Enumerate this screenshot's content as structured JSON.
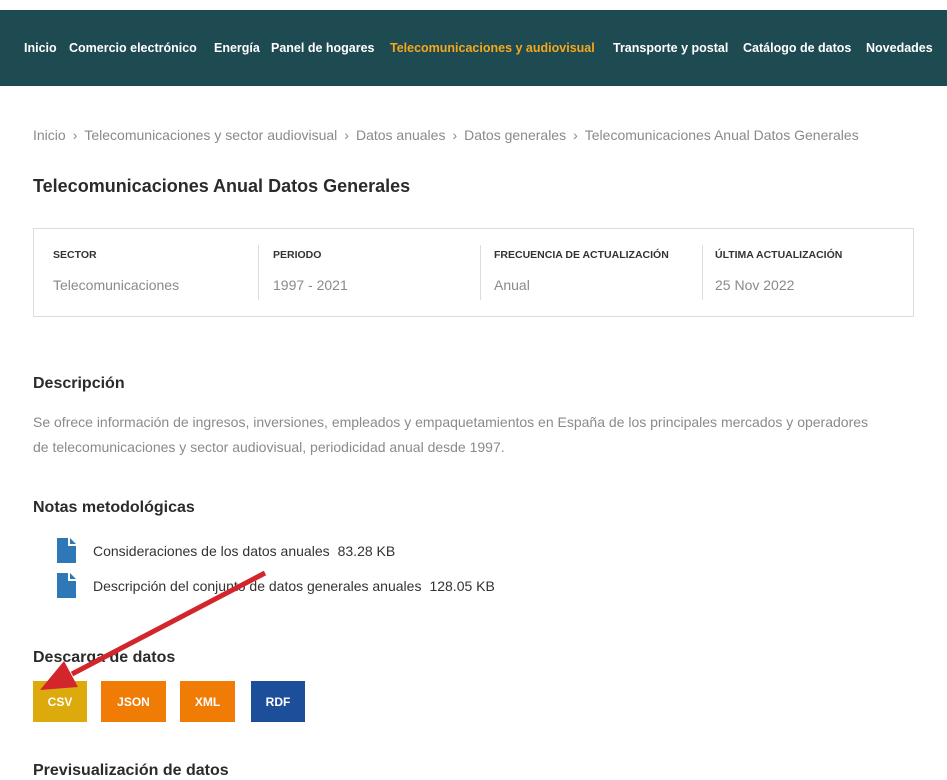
{
  "nav": {
    "items": [
      "Inicio",
      "Comercio electrónico",
      "Energía",
      "Panel de hogares",
      "Telecomunicaciones y audiovisual",
      "Transporte y postal",
      "Catálogo de datos",
      "Novedades"
    ],
    "active_index": 4
  },
  "breadcrumb": {
    "separator": "›",
    "items": [
      "Inicio",
      "Telecomunicaciones y sector audiovisual",
      "Datos anuales",
      "Datos generales",
      "Telecomunicaciones Anual Datos Generales"
    ]
  },
  "page_title": "Telecomunicaciones Anual Datos Generales",
  "summary": [
    {
      "label": "SECTOR",
      "value": "Telecomunicaciones"
    },
    {
      "label": "PERIODO",
      "value": "1997 - 2021"
    },
    {
      "label": "FRECUENCIA DE ACTUALIZACIÓN",
      "value": "Anual"
    },
    {
      "label": "ÚLTIMA ACTUALIZACIÓN",
      "value": "25 Nov 2022"
    }
  ],
  "description": {
    "heading": "Descripción",
    "text": "Se ofrece información de ingresos, inversiones, empleados y empaquetamientos en España de los principales mercados y operadores de telecomunicaciones y sector audiovisual, periodicidad anual desde 1997."
  },
  "notes": {
    "heading": "Notas metodológicas",
    "files": [
      {
        "icon": "file-icon",
        "name": "Consideraciones de los datos anuales",
        "size": "83.28 KB"
      },
      {
        "icon": "file-icon",
        "name": "Descripción del conjunto de datos generales anuales",
        "size": "128.05 KB"
      }
    ]
  },
  "downloads": {
    "heading": "Descarga de datos",
    "formats": [
      {
        "label": "CSV"
      },
      {
        "label": "JSON"
      },
      {
        "label": "XML"
      },
      {
        "label": "RDF"
      }
    ]
  },
  "preview": {
    "heading": "Previsualización de datos"
  },
  "colors": {
    "nav_bg": "#1e4a51",
    "nav_text": "#ffffff",
    "nav_active": "#f6a81c",
    "heading": "#2b2b2b",
    "muted": "#8a8a8a",
    "border": "#dcdcdc",
    "file_icon": "#2f78b7",
    "btn_csv": "#dcaa0c",
    "btn_json": "#f07b05",
    "btn_xml": "#f07b05",
    "btn_rdf": "#1c4e9a",
    "arrow": "#d3262c"
  }
}
